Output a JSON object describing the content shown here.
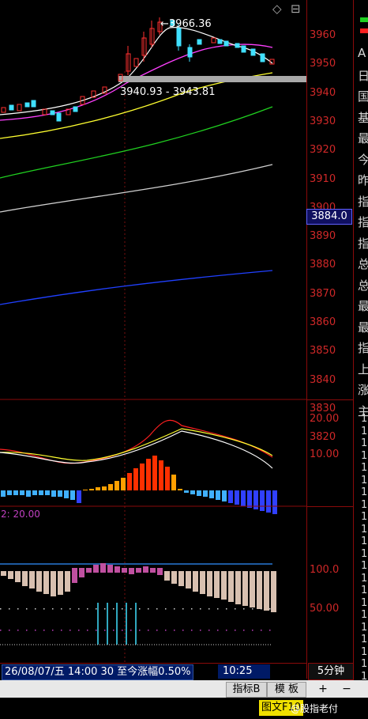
{
  "top_icons": {
    "diamond": "◇",
    "box": "⊟"
  },
  "price_axis": [
    "3960",
    "3950",
    "3940",
    "3930",
    "3920",
    "3910",
    "3900",
    "3890",
    "3880",
    "3870",
    "3860",
    "3850",
    "3840",
    "3830",
    "3820"
  ],
  "current_price_tag": "3884.0",
  "annotations": {
    "high": "3966.36",
    "range": "3940.93 - 3943.81"
  },
  "macd_axis": [
    "20.00",
    "10.00"
  ],
  "indicator3": {
    "param_label": "2: 20.00",
    "axis": [
      "100.0",
      "50.00"
    ]
  },
  "right_panel_chars": [
    "A",
    "日",
    "国",
    "基",
    "最",
    "今",
    "昨",
    "指",
    "指",
    "指",
    "总",
    "总",
    "最",
    "最",
    "指",
    "上",
    "涨",
    "主"
  ],
  "right_panel_col2": [
    "1",
    "1",
    "1",
    "1",
    "1",
    "1",
    "1",
    "1",
    "1",
    "1",
    "1",
    "1",
    "1",
    "1",
    "1",
    "1",
    "1",
    "1",
    "1",
    "1",
    "1",
    "1"
  ],
  "status_bar": {
    "date_text": "26/08/07/五 14:00 30 至今涨幅0.50%",
    "time": "10:25",
    "period": "5分钟"
  },
  "buttons": {
    "indicator": "指标B",
    "template": "模 板",
    "plus": "+",
    "minus": "−"
  },
  "bottom_strip": {
    "text": "图文F10",
    "watermark": "@股指老付"
  },
  "colors": {
    "up": "#ff3030",
    "down": "#40e0ff",
    "ma5": "#ffffff",
    "ma10": "#ff40ff",
    "ma20": "#ffff00",
    "ma60": "#00ff00",
    "ma120": "#d0d0d0",
    "ma250": "#2040ff"
  }
}
